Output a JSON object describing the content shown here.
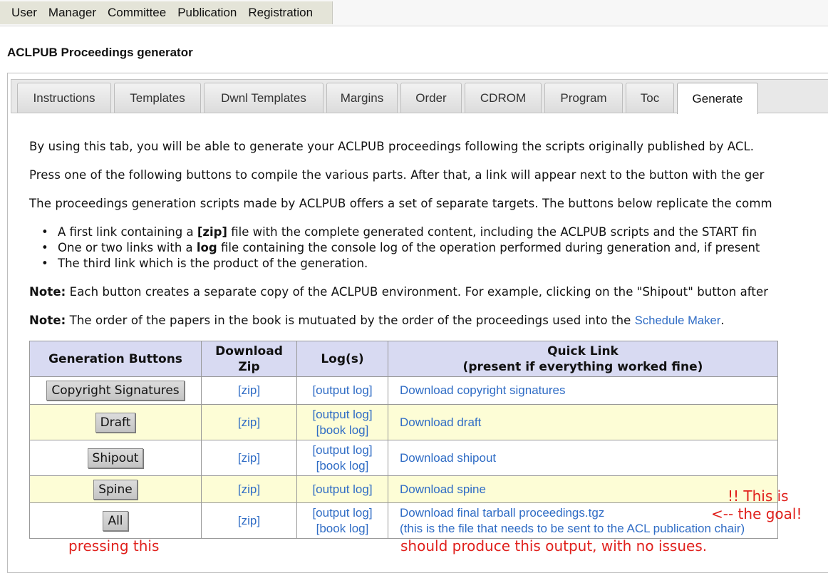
{
  "menubar": {
    "items": [
      "User",
      "Manager",
      "Committee",
      "Publication",
      "Registration"
    ]
  },
  "page_title": "ACLPUB Proceedings generator",
  "tabs": [
    "Instructions",
    "Templates",
    "Dwnl Templates",
    "Margins",
    "Order",
    "CDROM",
    "Program",
    "Toc",
    "Generate"
  ],
  "active_tab": "Generate",
  "intro": {
    "p1": "By using this tab, you will be able to generate your ACLPUB proceedings following the scripts originally published by ACL.",
    "p2": "Press one of the following buttons to compile the various parts. After that, a link will appear next to the button with the ger",
    "p3": "The proceedings generation scripts made by ACLPUB offers a set of separate targets. The buttons below replicate the comm",
    "bullet1_a": "A first link containing a ",
    "bullet1_b": "[zip]",
    "bullet1_c": " file with the complete generated content, including the ACLPUB scripts and the START fin",
    "bullet2_a": "One or two links with a ",
    "bullet2_b": "log",
    "bullet2_c": " file containing the console log of the operation performed during generation and, if present",
    "bullet3": "The third link which is the product of the generation.",
    "note_label": "Note:",
    "note1": " Each button creates a separate copy of the ACLPUB environment. For example, clicking on the \"Shipout\" button after",
    "note2_a": " The order of the papers in the book is mutuated by the order of the proceedings used into the ",
    "note2_link": "Schedule Maker",
    "note2_end": "."
  },
  "table": {
    "headers": {
      "buttons": "Generation Buttons",
      "zip_line1": "Download",
      "zip_line2": "Zip",
      "logs": "Log(s)",
      "quick_line1": "Quick Link",
      "quick_line2": "(present if everything worked fine)"
    },
    "rows": [
      {
        "button": "Copyright Signatures",
        "zip": "[zip]",
        "log1": "[output log]",
        "log2": "",
        "link": "Download copyright signatures",
        "link2": ""
      },
      {
        "button": "Draft",
        "zip": "[zip]",
        "log1": "[output log]",
        "log2": "[book log]",
        "link": "Download draft",
        "link2": ""
      },
      {
        "button": "Shipout",
        "zip": "[zip]",
        "log1": "[output log]",
        "log2": "[book log]",
        "link": "Download shipout",
        "link2": ""
      },
      {
        "button": "Spine",
        "zip": "[zip]",
        "log1": "[output log]",
        "log2": "",
        "link": "Download spine",
        "link2": ""
      },
      {
        "button": "All",
        "zip": "[zip]",
        "log1": "[output log]",
        "log2": "[book log]",
        "link": "Download final tarball proceedings.tgz",
        "link2": "(this is the file that needs to be sent to the ACL publication chair)"
      }
    ]
  },
  "annotations": {
    "goal_line1": "!! This is",
    "goal_line2": "<-- the goal!",
    "pressing": "pressing this",
    "output": "should produce this output, with no issues."
  },
  "colors": {
    "link": "#2f6cc5",
    "header_bg": "#d8daf2",
    "alt_row_bg": "#fdfdd6",
    "annotation": "#e0201c"
  }
}
